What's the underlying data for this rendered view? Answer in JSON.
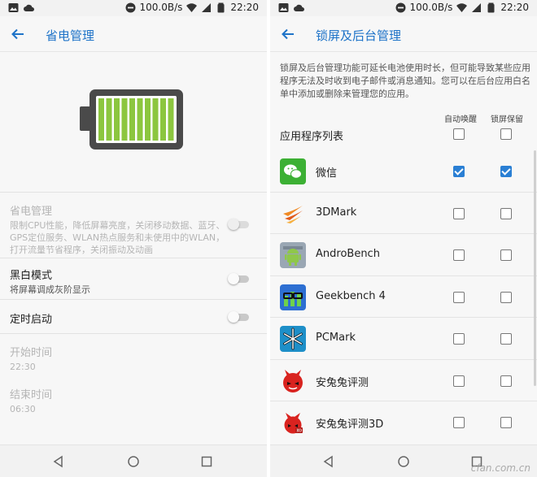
{
  "status_bar": {
    "speed": "100.0B/s",
    "time": "22:20"
  },
  "left": {
    "title": "省电管理",
    "settings": [
      {
        "title": "省电管理",
        "subtitle": "限制CPU性能，降低屏幕亮度，关闭移动数据、蓝牙、GPS定位服务、WLAN热点服务和未使用中的WLAN，打开流量节省程序，关闭振动及动画",
        "enabled": false
      },
      {
        "title": "黑白模式",
        "subtitle": "将屏幕调成灰阶显示",
        "enabled": true
      },
      {
        "title": "定时启动",
        "subtitle": "",
        "enabled": true
      },
      {
        "title": "开始时间",
        "subtitle": "22:30",
        "enabled": false
      },
      {
        "title": "结束时间",
        "subtitle": "06:30",
        "enabled": false
      }
    ]
  },
  "right": {
    "title": "锁屏及后台管理",
    "description": "锁屏及后台管理功能可延长电池使用时长，但可能导致某些应用程序无法及时收到电子邮件或消息通知。您可以在后台应用白名单中添加或删除来管理您的应用。",
    "col_auto_wake": "自动唤醒",
    "col_lock_keep": "锁屏保留",
    "list_header": "应用程序列表",
    "apps": [
      {
        "name": "微信",
        "icon": "wechat-icon",
        "auto_wake": true,
        "lock_keep": true
      },
      {
        "name": "3DMark",
        "icon": "3dmark-icon",
        "auto_wake": false,
        "lock_keep": false
      },
      {
        "name": "AndroBench",
        "icon": "android-icon",
        "auto_wake": false,
        "lock_keep": false
      },
      {
        "name": "Geekbench 4",
        "icon": "geekbench-icon",
        "auto_wake": false,
        "lock_keep": false
      },
      {
        "name": "PCMark",
        "icon": "pcmark-icon",
        "auto_wake": false,
        "lock_keep": false
      },
      {
        "name": "安兔兔评测",
        "icon": "antutu-icon",
        "auto_wake": false,
        "lock_keep": false
      },
      {
        "name": "安兔兔评测3D",
        "icon": "antutu-3d-icon",
        "auto_wake": false,
        "lock_keep": false
      }
    ]
  },
  "colors": {
    "accent": "#1e73c8",
    "checkbox": "#2a7fd4",
    "battery": "#8cc63f",
    "battery_frame": "#4a4a4a"
  },
  "watermark": "cfan.com.cn"
}
